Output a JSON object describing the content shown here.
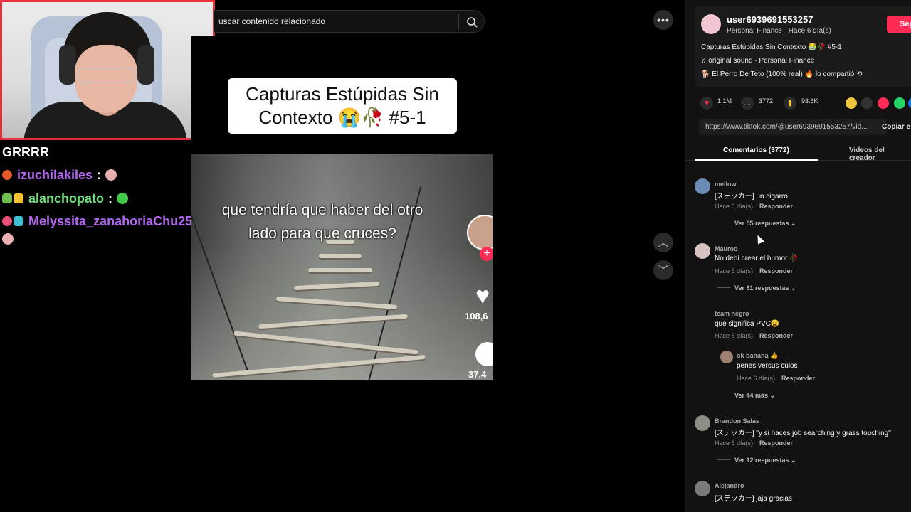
{
  "stream": {
    "chat": [
      {
        "user": "GRRRR",
        "color": "#ffffff"
      },
      {
        "user": "izuchilakiles",
        "color": "#b466f0"
      },
      {
        "user": "alanchopato",
        "color": "#6fe07a"
      },
      {
        "user": "Melyssita_zanahoriaChu25",
        "color": "#b466f0"
      }
    ],
    "colon": ":"
  },
  "search": {
    "placeholder": "uscar contenido relacionado"
  },
  "video": {
    "title_line1": "Capturas Estúpidas Sin",
    "title_line2": "Contexto 😭🥀 #5-1",
    "caption_line1": "que tendría que haber del otro",
    "caption_line2": "lado para que cruces?",
    "like_count": "108,6",
    "comment_count": "37,4"
  },
  "panel": {
    "creator": {
      "name": "user6939691553257",
      "sub": "Personal Finance · Hace 6 día(s)",
      "follow_label": "Seg"
    },
    "description": "Capturas Estúpidas Sin Contexto 😭🥀 #5-1",
    "sound": "♫  original sound - Personal Finance",
    "shared": "🐕 El Perro De Teto (100% real) 🔥 lo compartió  ⟲",
    "stats": {
      "likes": "1.1M",
      "comments": "3772",
      "saves": "93.6K"
    },
    "url": "https://www.tiktok.com/@user6939691553257/vid...",
    "copy_label": "Copiar e",
    "tabs": {
      "comments": "Comentarios (3772)",
      "creator_videos": "Videos del creador"
    },
    "reply_label": "Responder",
    "comments": [
      {
        "user": "mellow",
        "text": "[ステッカー] un cigarro",
        "time": "Hace 6 día(s)",
        "more": "Ver 55 respuestas ⌄",
        "avatar_color": "#6a8bb5"
      },
      {
        "user": "Mauroo",
        "text": "No debí crear el humor 🥀",
        "time": "Hace 6 día(s)",
        "more": "Ver 81 respuestas ⌄",
        "avatar_color": "#d9c2c2"
      },
      {
        "user": "team negro",
        "text": "que significa PVC😩",
        "time": "Hace 6 día(s)",
        "more": "",
        "avatar_color": "#111111"
      },
      {
        "user": "ok banana 👍",
        "text": "penes versus culos",
        "time": "Hace 6 día(s)",
        "more": "Ver 44 más ⌄",
        "avatar_color": "#a08070"
      },
      {
        "user": "Brandon Salas",
        "text": "[ステッカー] \"y si haces job searching y grass touching\"",
        "time": "Hace 6 día(s)",
        "more": "Ver 12 respuestas ⌄",
        "avatar_color": "#8a8f86"
      },
      {
        "user": "Alejandro",
        "text": "[ステッカー] jaja gracias",
        "time": "",
        "more": "",
        "avatar_color": "#7a7a7a"
      }
    ]
  },
  "colors": {
    "accent": "#fe2c55",
    "webcam_border": "#e2323e"
  }
}
